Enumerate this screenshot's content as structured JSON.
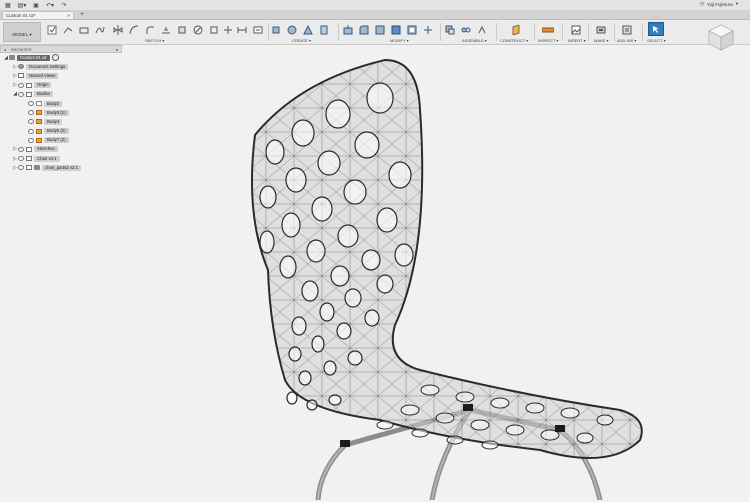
{
  "window": {
    "tab_title": "Custom 01 v2*",
    "tab_close": "×",
    "new_tab": "+",
    "user": "Yoji Fujimura"
  },
  "toolbar": {
    "workspace": "MODEL ▾",
    "groups": [
      {
        "label": "SKETCH ▾"
      },
      {
        "label": "CREATE ▾"
      },
      {
        "label": "MODIFY ▾"
      },
      {
        "label": "ASSEMBLE ▾"
      },
      {
        "label": "CONSTRUCT ▾"
      },
      {
        "label": "INSPECT ▾"
      },
      {
        "label": "INSERT ▾"
      },
      {
        "label": "MAKE ▾"
      },
      {
        "label": "ADD-INS ▾"
      },
      {
        "label": "SELECT ▾"
      }
    ]
  },
  "browser": {
    "title": "BROWSER",
    "root": "Custom 01 v2",
    "items": [
      {
        "label": "Document Settings"
      },
      {
        "label": "Named Views"
      },
      {
        "label": "Origin"
      },
      {
        "label": "Bodies"
      },
      {
        "label": "Body2"
      },
      {
        "label": "Body3 (1)"
      },
      {
        "label": "Body4"
      },
      {
        "label": "Body5 (2)"
      },
      {
        "label": "Body7 (2)"
      },
      {
        "label": "Sketches"
      },
      {
        "label": "Chair v4:1"
      },
      {
        "label": "chair_parts2 v2:1"
      }
    ]
  },
  "icons": {
    "settings": "gear-icon",
    "folder": "folder-icon",
    "body": "body-icon",
    "component": "component-icon",
    "visibility": "eye-icon"
  },
  "colors": {
    "select_accent": "#2f7fbf",
    "body_highlight": "#f1a23d",
    "toolbar_bg": "#ebebeb",
    "canvas_bg": "#f1f1f1"
  }
}
